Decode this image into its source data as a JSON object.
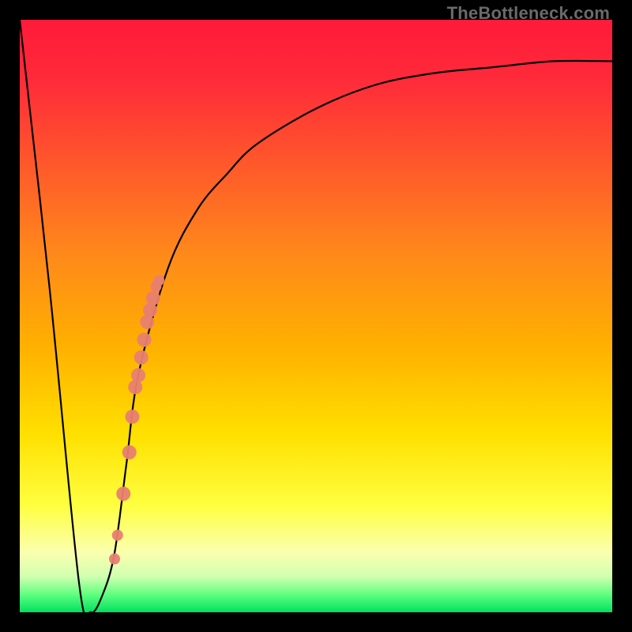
{
  "watermark": "TheBottleneck.com",
  "chart_data": {
    "type": "line",
    "title": "",
    "xlabel": "",
    "ylabel": "",
    "xlim": [
      0,
      100
    ],
    "ylim": [
      0,
      100
    ],
    "series": [
      {
        "name": "bottleneck-curve",
        "x": [
          0,
          5,
          10,
          12,
          14,
          16,
          18,
          20,
          25,
          30,
          35,
          40,
          50,
          60,
          70,
          80,
          90,
          100
        ],
        "values": [
          100,
          55,
          5,
          0,
          3,
          10,
          25,
          40,
          58,
          68,
          74,
          79,
          85,
          89,
          91,
          92,
          93,
          93
        ]
      }
    ],
    "markers": {
      "name": "highlighted-points",
      "color": "#e88070",
      "points": [
        {
          "x": 16.0,
          "y": 9
        },
        {
          "x": 16.5,
          "y": 13
        },
        {
          "x": 17.5,
          "y": 20
        },
        {
          "x": 18.5,
          "y": 27
        },
        {
          "x": 19.0,
          "y": 33
        },
        {
          "x": 19.5,
          "y": 38
        },
        {
          "x": 20.0,
          "y": 40
        },
        {
          "x": 20.5,
          "y": 43
        },
        {
          "x": 21.0,
          "y": 46
        },
        {
          "x": 21.5,
          "y": 49
        },
        {
          "x": 22.0,
          "y": 51
        },
        {
          "x": 22.5,
          "y": 53
        },
        {
          "x": 23.0,
          "y": 55
        },
        {
          "x": 23.5,
          "y": 56
        }
      ]
    },
    "gradient_meaning": "red = bad / bottleneck, green = optimal"
  }
}
